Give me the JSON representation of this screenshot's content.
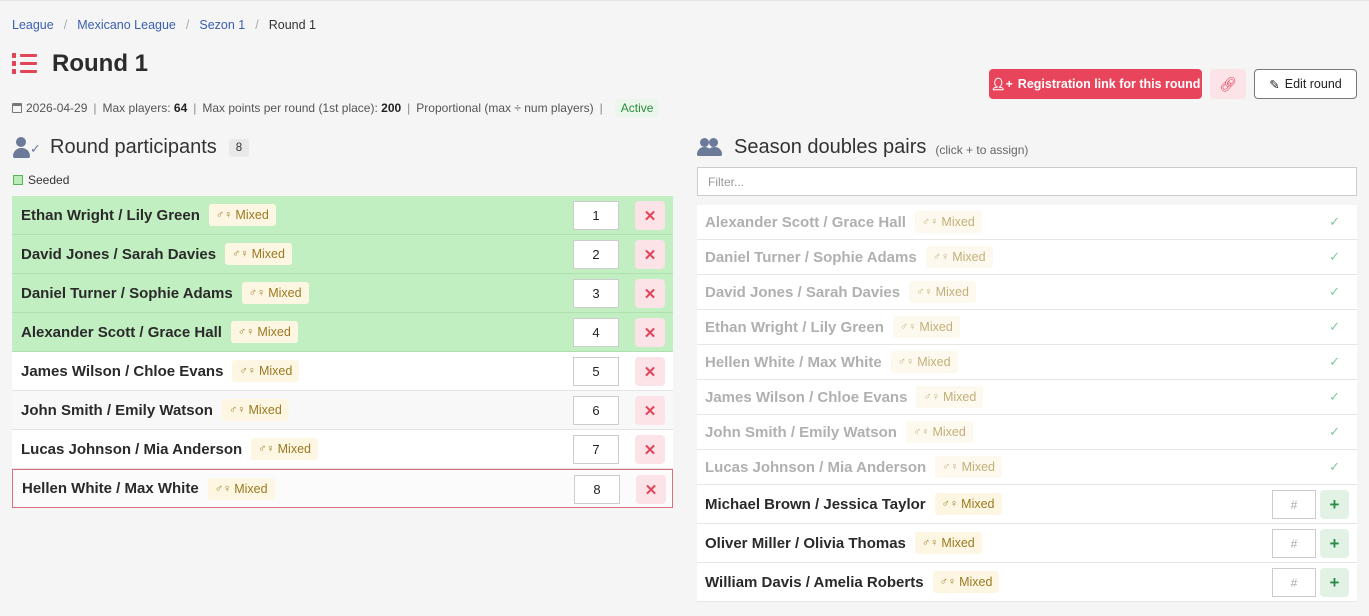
{
  "breadcrumb": [
    "League",
    "Mexicano League",
    "Sezon 1"
  ],
  "breadcrumb_current": "Round 1",
  "title": "Round 1",
  "meta": {
    "date": "2026-04-29",
    "max_players_label": "Max players:",
    "max_players": "64",
    "max_points_label": "Max points per round (1st place):",
    "max_points": "200",
    "mode": "Proportional (max ÷ num players)",
    "status": "Active"
  },
  "buttons": {
    "registration": "Registration link for this round",
    "edit": "Edit round"
  },
  "participants_section": {
    "title": "Round participants",
    "count": "8",
    "legend": "Seeded"
  },
  "participants": [
    {
      "name": "Ethan Wright / Lily Green",
      "badge": "Mixed",
      "seed": "1",
      "seeded": true
    },
    {
      "name": "David Jones / Sarah Davies",
      "badge": "Mixed",
      "seed": "2",
      "seeded": true
    },
    {
      "name": "Daniel Turner / Sophie Adams",
      "badge": "Mixed",
      "seed": "3",
      "seeded": true
    },
    {
      "name": "Alexander Scott / Grace Hall",
      "badge": "Mixed",
      "seed": "4",
      "seeded": true
    },
    {
      "name": "James Wilson / Chloe Evans",
      "badge": "Mixed",
      "seed": "5",
      "seeded": false
    },
    {
      "name": "John Smith / Emily Watson",
      "badge": "Mixed",
      "seed": "6",
      "seeded": false
    },
    {
      "name": "Lucas Johnson / Mia Anderson",
      "badge": "Mixed",
      "seed": "7",
      "seeded": false
    },
    {
      "name": "Hellen White / Max White",
      "badge": "Mixed",
      "seed": "8",
      "seeded": false,
      "selected": true
    }
  ],
  "pairs_section": {
    "title": "Season doubles pairs",
    "hint": "(click + to assign)",
    "filter_placeholder": "Filter..."
  },
  "pairs": [
    {
      "name": "Alexander Scott / Grace Hall",
      "badge": "Mixed",
      "assigned": true
    },
    {
      "name": "Daniel Turner / Sophie Adams",
      "badge": "Mixed",
      "assigned": true
    },
    {
      "name": "David Jones / Sarah Davies",
      "badge": "Mixed",
      "assigned": true
    },
    {
      "name": "Ethan Wright / Lily Green",
      "badge": "Mixed",
      "assigned": true
    },
    {
      "name": "Hellen White / Max White",
      "badge": "Mixed",
      "assigned": true
    },
    {
      "name": "James Wilson / Chloe Evans",
      "badge": "Mixed",
      "assigned": true
    },
    {
      "name": "John Smith / Emily Watson",
      "badge": "Mixed",
      "assigned": true
    },
    {
      "name": "Lucas Johnson / Mia Anderson",
      "badge": "Mixed",
      "assigned": true
    },
    {
      "name": "Michael Brown / Jessica Taylor",
      "badge": "Mixed",
      "assigned": false,
      "placeholder": "#"
    },
    {
      "name": "Oliver Miller / Olivia Thomas",
      "badge": "Mixed",
      "assigned": false,
      "placeholder": "#"
    },
    {
      "name": "William Davis / Amelia Roberts",
      "badge": "Mixed",
      "assigned": false,
      "placeholder": "#"
    }
  ],
  "colors": {
    "accent": "#e8455c",
    "seeded": "#c2efc2",
    "link": "#3a5fb0"
  }
}
